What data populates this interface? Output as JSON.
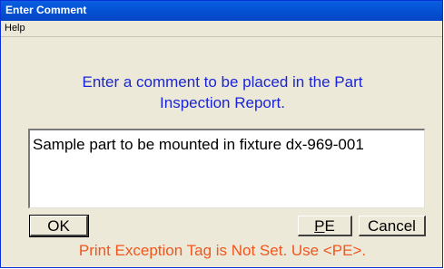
{
  "window": {
    "title": "Enter Comment"
  },
  "menu": {
    "items": [
      "Help"
    ]
  },
  "prompt": {
    "line1": "Enter a comment to be placed in the Part",
    "line2": "Inspection Report."
  },
  "comment": {
    "value": "Sample part to be mounted in fixture dx-969-001"
  },
  "buttons": {
    "ok": "OK",
    "pe_underlined": "P",
    "pe_rest": "E",
    "cancel": "Cancel"
  },
  "status": {
    "text": "Print Exception Tag is Not Set. Use <PE>."
  },
  "colors": {
    "titlebar": "#0553d6",
    "prompt_text": "#1a24d8",
    "status_text": "#f0561e",
    "dialog_bg": "#ece9d8"
  }
}
